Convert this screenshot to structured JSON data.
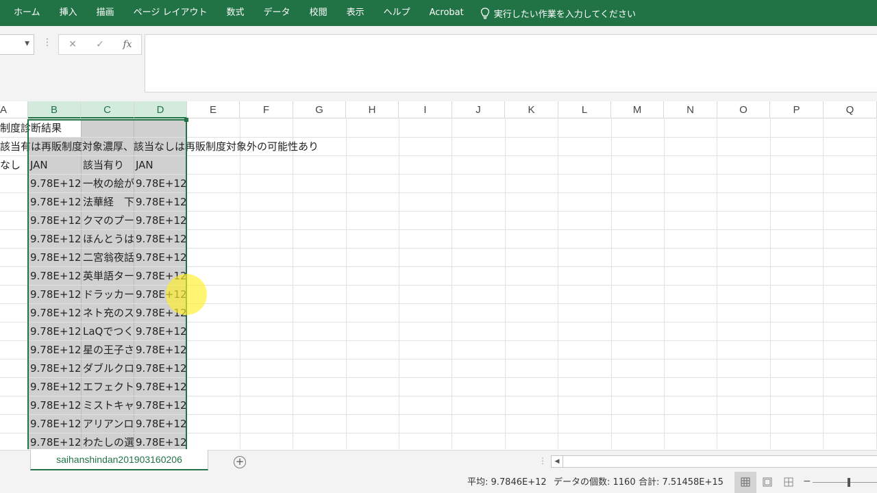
{
  "ribbon": {
    "tabs": [
      "ホーム",
      "挿入",
      "描画",
      "ページ レイアウト",
      "数式",
      "データ",
      "校閲",
      "表示",
      "ヘルプ",
      "Acrobat"
    ],
    "tell_me": "実行したい作業を入力してください"
  },
  "formula_bar": {
    "cancel_symbol": "✕",
    "enter_symbol": "✓",
    "fx_label": "fx",
    "value": ""
  },
  "columns": [
    "A",
    "B",
    "C",
    "D",
    "E",
    "F",
    "G",
    "H",
    "I",
    "J",
    "K",
    "L",
    "M",
    "N",
    "O",
    "P",
    "Q"
  ],
  "selected_columns": [
    "B",
    "C",
    "D"
  ],
  "rows": {
    "r1": {
      "a": "制度診断結果"
    },
    "r2": {
      "a": "該当有は再販制度対象濃厚、該当なしは再販制度対象外の可能性あり"
    },
    "r3": {
      "a": "なし",
      "b": "JAN",
      "c": "該当有り",
      "d": "JAN"
    },
    "data": [
      {
        "b": "9.78E+12",
        "c": "一枚の絵が",
        "d": "9.78E+12"
      },
      {
        "b": "9.78E+12",
        "c": "法華経　下",
        "d": "9.78E+12"
      },
      {
        "b": "9.78E+12",
        "c": "クマのプー",
        "d": "9.78E+12"
      },
      {
        "b": "9.78E+12",
        "c": "ほんとうは",
        "d": "9.78E+12"
      },
      {
        "b": "9.78E+12",
        "c": "二宮翁夜話",
        "d": "9.78E+12"
      },
      {
        "b": "9.78E+12",
        "c": "英単語ター",
        "d": "9.78E+12"
      },
      {
        "b": "9.78E+12",
        "c": "ドラッカー",
        "d": "9.78E+12"
      },
      {
        "b": "9.78E+12",
        "c": "ネト充のス",
        "d": "9.78E+12"
      },
      {
        "b": "9.78E+12",
        "c": "LaQでつく",
        "d": "9.78E+12"
      },
      {
        "b": "9.78E+12",
        "c": "星の王子さ",
        "d": "9.78E+12"
      },
      {
        "b": "9.78E+12",
        "c": "ダブルクロ",
        "d": "9.78E+12"
      },
      {
        "b": "9.78E+12",
        "c": "エフェクト",
        "d": "9.78E+12"
      },
      {
        "b": "9.78E+12",
        "c": "ミストキャ",
        "d": "9.78E+12"
      },
      {
        "b": "9.78E+12",
        "c": "アリアンロ",
        "d": "9.78E+12"
      },
      {
        "b": "9.78E+12",
        "c": "わたしの選",
        "d": "9.78E+12"
      }
    ]
  },
  "sheet_tab": "saihanshindan201903160206",
  "add_sheet_symbol": "+",
  "status": {
    "average": "平均: 9.7846E+12",
    "count": "データの個数: 1160",
    "sum": "合計: 7.51458E+15"
  },
  "colors": {
    "accent": "#217346",
    "selection_shade": "#d0d0d0",
    "header_selected": "#d3ebdc"
  }
}
